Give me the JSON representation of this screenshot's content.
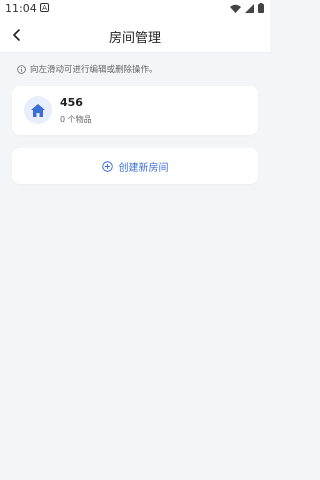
{
  "status_bar": {
    "time": "11:04",
    "badge": "A"
  },
  "app_bar": {
    "title": "房间管理",
    "back_icon": "back-arrow-icon"
  },
  "hint": {
    "text": "向左滑动可进行编辑或删除操作。",
    "icon": "info-circle-icon"
  },
  "rooms": [
    {
      "name": "456",
      "count_text": "0 个物品",
      "icon": "home-icon"
    }
  ],
  "create_button": {
    "label": "创建新房间",
    "icon": "plus-circle-icon"
  },
  "colors": {
    "accent": "#3a6fd8",
    "background": "#f4f5f9",
    "card": "#ffffff"
  }
}
